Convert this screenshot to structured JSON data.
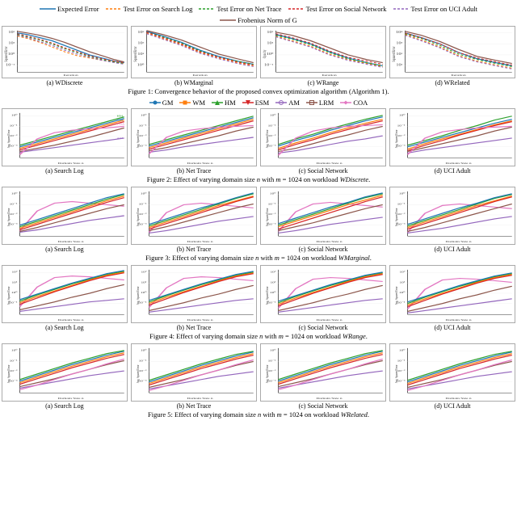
{
  "legends": {
    "fig1": {
      "items": [
        {
          "label": "Expected Error",
          "color": "#1f77b4",
          "style": "solid"
        },
        {
          "label": "Test Error on Search Log",
          "color": "#ff7f0e",
          "style": "dashed"
        },
        {
          "label": "Test Error on Net Trace",
          "color": "#2ca02c",
          "style": "dashed"
        },
        {
          "label": "Test Error on Social Network",
          "color": "#d62728",
          "style": "dashed"
        },
        {
          "label": "Test Error on UCI Adult",
          "color": "#9467bd",
          "style": "dashed"
        },
        {
          "label": "Frobenius Norm of G",
          "color": "#8c564b",
          "style": "solid"
        }
      ]
    },
    "fig2to5": {
      "items": [
        {
          "label": "GM",
          "color": "#1f77b4",
          "marker": "o"
        },
        {
          "label": "WM",
          "color": "#ff7f0e",
          "marker": "s"
        },
        {
          "label": "HM",
          "color": "#2ca02c",
          "marker": "^"
        },
        {
          "label": "ESM",
          "color": "#d62728",
          "marker": "v"
        },
        {
          "label": "AM",
          "color": "#9467bd",
          "marker": "o"
        },
        {
          "label": "LRM",
          "color": "#8c564b",
          "marker": "s"
        },
        {
          "label": "COA",
          "color": "#e377c2",
          "marker": "D"
        }
      ]
    }
  },
  "figures": {
    "fig1": {
      "title": "Figure 1: Convergence behavior of the proposed convex optimization algorithm (Algorithm 1).",
      "subfigs": [
        {
          "label": "(a) WDiscrete"
        },
        {
          "label": "(b) WMarginal"
        },
        {
          "label": "(c) WRange"
        },
        {
          "label": "(d) WRelated"
        }
      ]
    },
    "fig2": {
      "title": "Figure 2: Effect of varying domain size n with m = 1024 on workload WDiscrete.",
      "subfigs": [
        {
          "label": "(a) Search Log"
        },
        {
          "label": "(b) Net Trace"
        },
        {
          "label": "(c) Social Network"
        },
        {
          "label": "(d) UCI Adult"
        }
      ]
    },
    "fig3": {
      "title": "Figure 3: Effect of varying domain size n with m = 1024 on workload WMarginal.",
      "subfigs": [
        {
          "label": "(a) Search Log"
        },
        {
          "label": "(b) Net Trace"
        },
        {
          "label": "(c) Social Network"
        },
        {
          "label": "(d) UCI Adult"
        }
      ]
    },
    "fig4": {
      "title": "Figure 4: Effect of varying domain size n with m = 1024 on workload WRange.",
      "subfigs": [
        {
          "label": "(a) Search Log"
        },
        {
          "label": "(b) Net Trace"
        },
        {
          "label": "(c) Social Network"
        },
        {
          "label": "(d) UCI Adult"
        }
      ]
    },
    "fig5": {
      "title": "Figure 5: Effect of varying domain size n with m = 1024 on workload WRelated.",
      "subfigs": [
        {
          "label": "(a) Search Log"
        },
        {
          "label": "(b) Net Trace"
        },
        {
          "label": "(c) Social Network"
        },
        {
          "label": "(d) UCI Adult"
        }
      ]
    }
  },
  "yaxis_label": "Avg. Squared Error",
  "xaxis_label": "Domain Size n"
}
